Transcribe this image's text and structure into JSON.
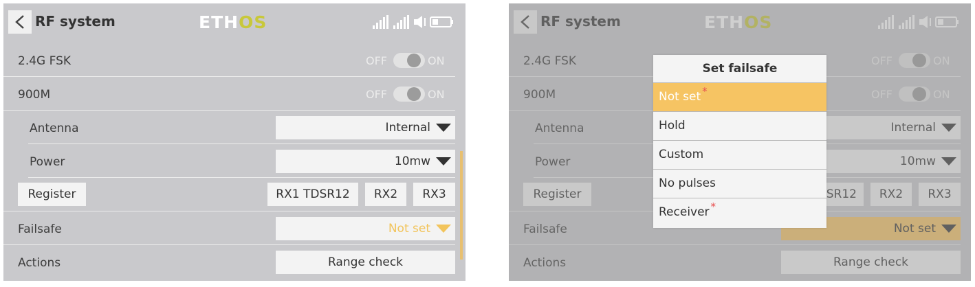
{
  "screens": [
    {
      "header": {
        "title": "RF system",
        "logo_main": "ETH",
        "logo_accent": "OS"
      },
      "modules": [
        {
          "label": "2.4G FSK",
          "off_label": "OFF",
          "on_label": "ON"
        },
        {
          "label": "900M",
          "off_label": "OFF",
          "on_label": "ON"
        }
      ],
      "antenna": {
        "label": "Antenna",
        "value": "Internal"
      },
      "power": {
        "label": "Power",
        "value": "10mw"
      },
      "register": {
        "label": "Register",
        "rx1": "RX1 TDSR12",
        "rx2": "RX2",
        "rx3": "RX3"
      },
      "failsafe": {
        "label": "Failsafe",
        "value": "Not set"
      },
      "actions": {
        "label": "Actions",
        "value": "Range check"
      }
    },
    {
      "header": {
        "title": "RF system",
        "logo_main": "ETH",
        "logo_accent": "OS"
      },
      "modules": [
        {
          "label": "2.4G FSK",
          "off_label": "OFF",
          "on_label": "ON"
        },
        {
          "label": "900M",
          "off_label": "OFF",
          "on_label": "ON"
        }
      ],
      "antenna": {
        "label": "Antenna",
        "value": "Internal"
      },
      "power": {
        "label": "Power",
        "value": "10mw"
      },
      "register": {
        "label": "Register",
        "rx1_partial": "SR12",
        "rx2": "RX2",
        "rx3": "RX3"
      },
      "failsafe": {
        "label": "Failsafe",
        "value": "Not set"
      },
      "actions": {
        "label": "Actions",
        "value": "Range check"
      },
      "popup": {
        "title": "Set failsafe",
        "items": [
          {
            "label": "Not set",
            "required": "*"
          },
          {
            "label": "Hold"
          },
          {
            "label": "Custom"
          },
          {
            "label": "No pulses"
          },
          {
            "label": "Receiver",
            "required": "*"
          }
        ],
        "selected_index": 0
      }
    }
  ],
  "colors": {
    "accent": "#f6c463",
    "failsafe_text": "#f2c45c",
    "logo_os": "#c8c83a",
    "screen_bg": "#c9c9cc"
  },
  "icons": [
    "back-arrow-icon",
    "signal-24g-icon",
    "signal-900m-icon",
    "volume-icon",
    "battery-icon"
  ]
}
